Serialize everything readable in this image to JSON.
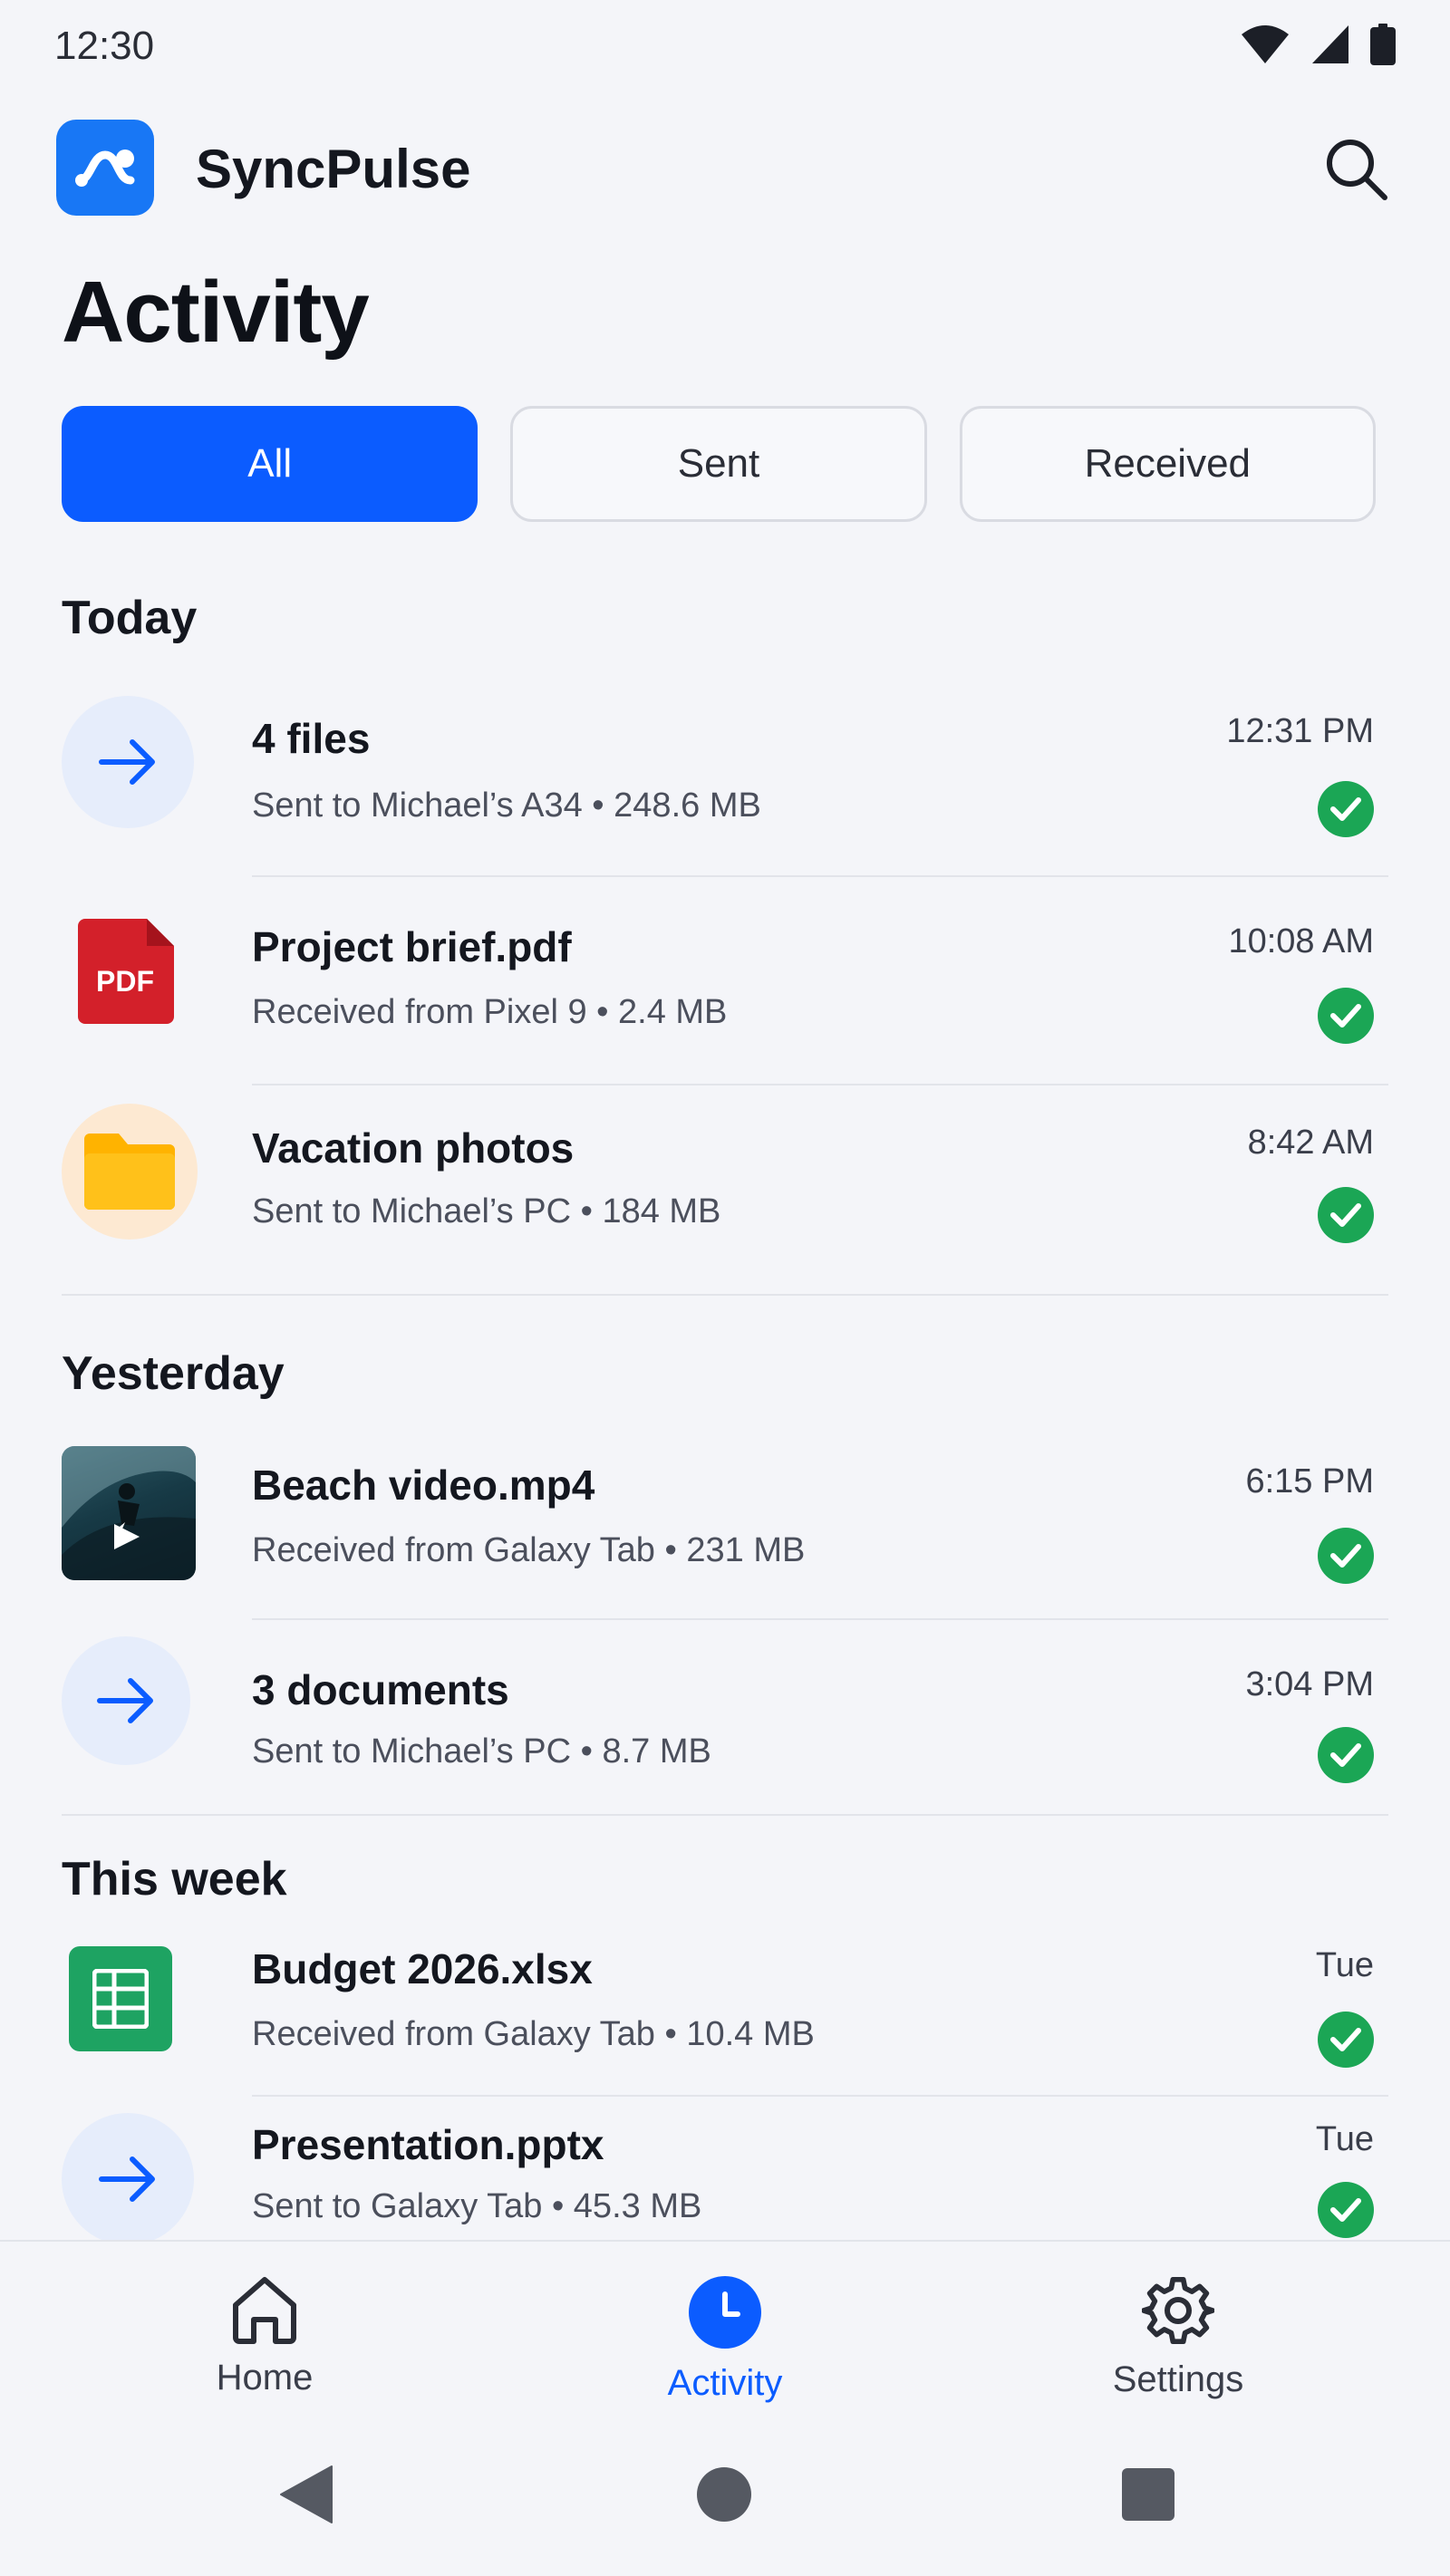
{
  "status_bar": {
    "time": "12:30"
  },
  "app": {
    "name": "SyncPulse"
  },
  "page": {
    "title": "Activity"
  },
  "filters": [
    {
      "label": "All",
      "active": true
    },
    {
      "label": "Sent",
      "active": false
    },
    {
      "label": "Received",
      "active": false
    }
  ],
  "sections": {
    "today": {
      "title": "Today",
      "items": [
        {
          "name": "4 files",
          "meta": "Sent to Michael’s A34 • 248.6 MB",
          "time": "12:31 PM",
          "icon": "send-arrow-icon"
        },
        {
          "name": "Project brief.pdf",
          "meta": "Received from Pixel 9 • 2.4 MB",
          "time": "10:08 AM",
          "icon": "pdf-file-icon",
          "icon_text": "PDF"
        },
        {
          "name": "Vacation photos",
          "meta": "Sent to Michael’s PC • 184 MB",
          "time": "8:42 AM",
          "icon": "folder-icon"
        }
      ]
    },
    "yesterday": {
      "title": "Yesterday",
      "items": [
        {
          "name": "Beach video.mp4",
          "meta": "Received from Galaxy Tab • 231 MB",
          "time": "6:15 PM",
          "icon": "video-thumbnail-icon"
        },
        {
          "name": "3 documents",
          "meta": "Sent to Michael’s PC • 8.7 MB",
          "time": "3:04 PM",
          "icon": "send-arrow-icon"
        }
      ]
    },
    "this_week": {
      "title": "This week",
      "items": [
        {
          "name": "Budget 2026.xlsx",
          "meta": "Received from Galaxy Tab • 10.4 MB",
          "time": "Tue",
          "icon": "spreadsheet-icon"
        },
        {
          "name": "Presentation.pptx",
          "meta": "Sent to Galaxy Tab • 45.3 MB",
          "time": "Tue",
          "icon": "send-arrow-icon"
        }
      ]
    }
  },
  "bottom_nav": [
    {
      "label": "Home",
      "icon": "home-icon",
      "active": false
    },
    {
      "label": "Activity",
      "icon": "clock-icon",
      "active": true
    },
    {
      "label": "Settings",
      "icon": "gear-icon",
      "active": false
    }
  ],
  "colors": {
    "accent": "#0b5cff",
    "success": "#1ba655",
    "pdf": "#d3202a",
    "folder": "#ffb300",
    "sheet": "#1ea362"
  }
}
